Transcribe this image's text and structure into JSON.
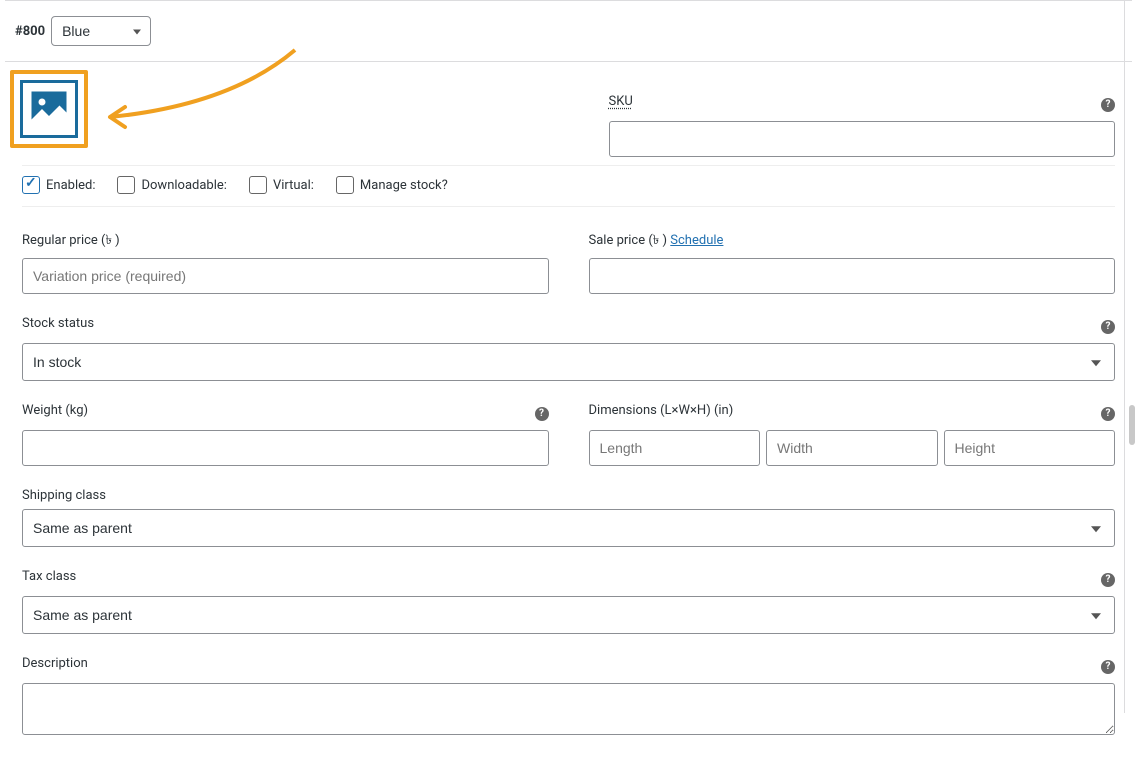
{
  "header": {
    "variation_id": "#800",
    "attribute_selected": "Blue"
  },
  "sku": {
    "label": "SKU",
    "value": ""
  },
  "checkboxes": {
    "enabled": {
      "label": "Enabled:",
      "checked": true
    },
    "downloadable": {
      "label": "Downloadable:",
      "checked": false
    },
    "virtual": {
      "label": "Virtual:",
      "checked": false
    },
    "manage_stock": {
      "label": "Manage stock?",
      "checked": false
    }
  },
  "pricing": {
    "regular_label": "Regular price (৳ )",
    "regular_placeholder": "Variation price (required)",
    "regular_value": "",
    "sale_label": "Sale price (৳ )",
    "sale_value": "",
    "schedule_text": "Schedule"
  },
  "stock": {
    "label": "Stock status",
    "value": "In stock"
  },
  "shipping": {
    "weight_label": "Weight (kg)",
    "weight_value": "",
    "dimensions_label": "Dimensions (L×W×H) (in)",
    "length_placeholder": "Length",
    "width_placeholder": "Width",
    "height_placeholder": "Height",
    "class_label": "Shipping class",
    "class_value": "Same as parent"
  },
  "tax": {
    "label": "Tax class",
    "value": "Same as parent"
  },
  "description": {
    "label": "Description",
    "value": ""
  }
}
